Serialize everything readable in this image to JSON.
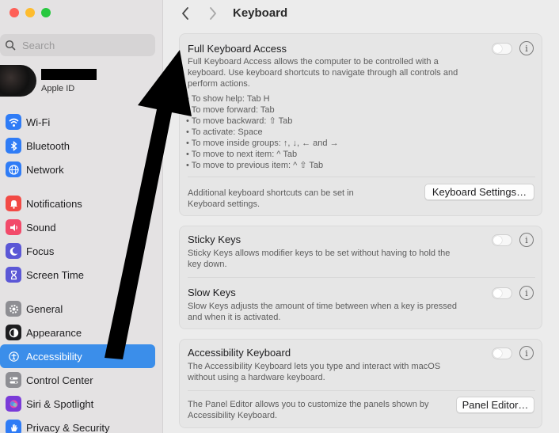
{
  "window": {
    "title": "Keyboard"
  },
  "search": {
    "placeholder": "Search"
  },
  "account": {
    "label": "Apple ID"
  },
  "sidebar": {
    "items": [
      {
        "label": "Wi-Fi",
        "icon": "wifi-icon",
        "color": "#2f7cf6"
      },
      {
        "label": "Bluetooth",
        "icon": "bluetooth-icon",
        "color": "#2f7cf6"
      },
      {
        "label": "Network",
        "icon": "globe-icon",
        "color": "#2f7cf6"
      },
      {
        "label": "Notifications",
        "icon": "bell-icon",
        "color": "#f24a45"
      },
      {
        "label": "Sound",
        "icon": "speaker-icon",
        "color": "#f24a6a"
      },
      {
        "label": "Focus",
        "icon": "moon-icon",
        "color": "#5b57d6"
      },
      {
        "label": "Screen Time",
        "icon": "hourglass-icon",
        "color": "#5b57d6"
      },
      {
        "label": "General",
        "icon": "gear-icon",
        "color": "#8e8e93"
      },
      {
        "label": "Appearance",
        "icon": "appearance-icon",
        "color": "#1d1d1f"
      },
      {
        "label": "Accessibility",
        "icon": "accessibility-icon",
        "color": "#2f7cf6",
        "active": true
      },
      {
        "label": "Control Center",
        "icon": "control-center-icon",
        "color": "#8e8e93"
      },
      {
        "label": "Siri & Spotlight",
        "icon": "siri-icon",
        "color": "#7a3bd8"
      },
      {
        "label": "Privacy & Security",
        "icon": "hand-icon",
        "color": "#2f7cf6"
      }
    ]
  },
  "full_keyboard_access": {
    "title": "Full Keyboard Access",
    "description": [
      "Full Keyboard Access allows the computer to be controlled with a",
      "keyboard. Use keyboard shortcuts to navigate through all controls and",
      "perform actions."
    ],
    "shortcuts": [
      "• To show help: Tab H",
      "• To move forward: Tab",
      "• To move backward: ⇧ Tab",
      "• To activate: Space",
      "• To move inside groups: ↑, ↓, ← and →",
      "• To move to next item: ^ Tab",
      "• To move to previous item: ^ ⇧ Tab"
    ],
    "footer": [
      "Additional keyboard shortcuts can be set in",
      "Keyboard settings."
    ],
    "button": "Keyboard Settings…",
    "enabled": false
  },
  "sticky_keys": {
    "title": "Sticky Keys",
    "description": [
      "Sticky Keys allows modifier keys to be set without having to hold the",
      "key down."
    ],
    "enabled": false
  },
  "slow_keys": {
    "title": "Slow Keys",
    "description": [
      "Slow Keys adjusts the amount of time between when a key is pressed",
      "and when it is activated."
    ],
    "enabled": false
  },
  "accessibility_keyboard": {
    "title": "Accessibility Keyboard",
    "description": [
      "The Accessibility Keyboard lets you type and interact with macOS",
      "without using a hardware keyboard."
    ],
    "footer": [
      "The Panel Editor allows you to customize the panels shown by",
      "Accessibility Keyboard."
    ],
    "button": "Panel Editor…",
    "enabled": false
  },
  "info_glyph": "i"
}
